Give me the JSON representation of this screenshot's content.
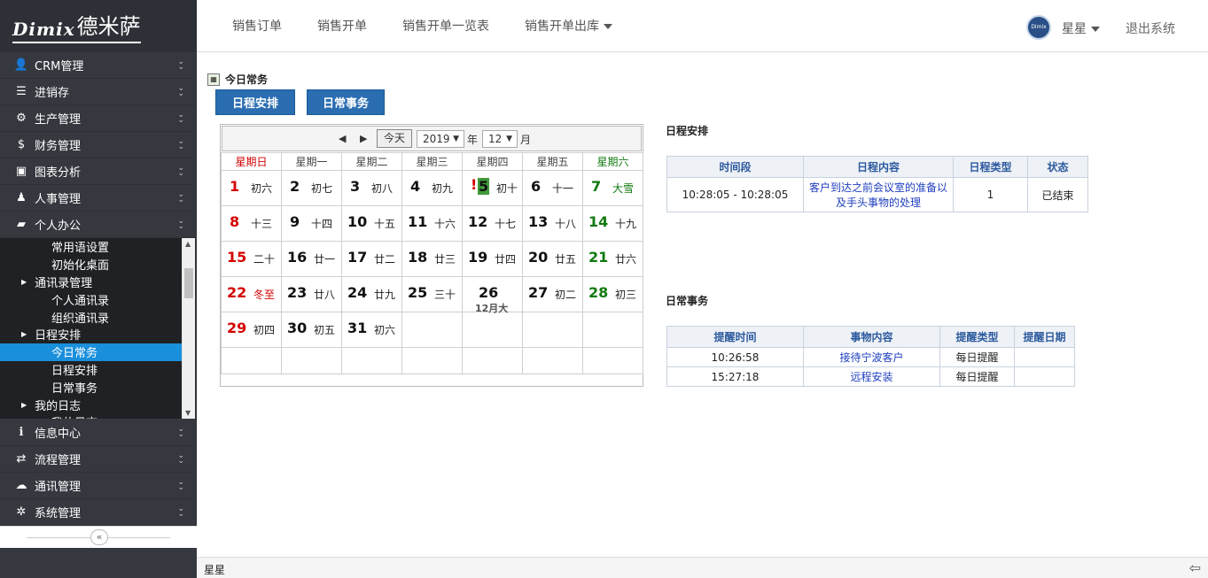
{
  "logo": {
    "brand": "Dimix",
    "cn": "德米萨"
  },
  "menu": [
    {
      "icon": "👤",
      "label": "CRM管理"
    },
    {
      "icon": "☰",
      "label": "进销存"
    },
    {
      "icon": "⚙",
      "label": "生产管理"
    },
    {
      "icon": "$",
      "label": "财务管理"
    },
    {
      "icon": "▣",
      "label": "图表分析"
    },
    {
      "icon": "♟",
      "label": "人事管理"
    },
    {
      "icon": "▰",
      "label": "个人办公"
    }
  ],
  "submenu": [
    {
      "label": "常用语设置",
      "level": 2
    },
    {
      "label": "初始化桌面",
      "level": 2
    },
    {
      "label": "通讯录管理",
      "level": 1
    },
    {
      "label": "个人通讯录",
      "level": 2
    },
    {
      "label": "组织通讯录",
      "level": 2
    },
    {
      "label": "日程安排",
      "level": 1
    },
    {
      "label": "今日常务",
      "level": 2,
      "active": true
    },
    {
      "label": "日程安排",
      "level": 2
    },
    {
      "label": "日常事务",
      "level": 2
    },
    {
      "label": "我的日志",
      "level": 1
    },
    {
      "label": "我的日志",
      "level": 2
    }
  ],
  "menu2": [
    {
      "icon": "ℹ",
      "label": "信息中心"
    },
    {
      "icon": "⇄",
      "label": "流程管理"
    },
    {
      "icon": "☁",
      "label": "通讯管理"
    },
    {
      "icon": "✲",
      "label": "系统管理"
    }
  ],
  "topnav": {
    "items": [
      "销售订单",
      "销售开单",
      "销售开单一览表",
      "销售开单出库"
    ],
    "avatar_text": "Dimix 德米萨",
    "user": "星星",
    "logout": "退出系统"
  },
  "page": {
    "title": "今日常务",
    "tab_schedule": "日程安排",
    "tab_affairs": "日常事务"
  },
  "calendar": {
    "today_label": "今天",
    "year": "2019",
    "year_suffix": "年",
    "month": "12",
    "month_suffix": "月",
    "weekdays": [
      "星期日",
      "星期一",
      "星期二",
      "星期三",
      "星期四",
      "星期五",
      "星期六"
    ],
    "weeks": [
      [
        {
          "d": "1",
          "l": "初六"
        },
        {
          "d": "2",
          "l": "初七"
        },
        {
          "d": "3",
          "l": "初八"
        },
        {
          "d": "4",
          "l": "初九"
        },
        {
          "d": "5",
          "l": "初十",
          "mark": "!"
        },
        {
          "d": "6",
          "l": "十一"
        },
        {
          "d": "7",
          "l": "大雪"
        }
      ],
      [
        {
          "d": "8",
          "l": "十三"
        },
        {
          "d": "9",
          "l": "十四"
        },
        {
          "d": "10",
          "l": "十五"
        },
        {
          "d": "11",
          "l": "十六"
        },
        {
          "d": "12",
          "l": "十七"
        },
        {
          "d": "13",
          "l": "十八"
        },
        {
          "d": "14",
          "l": "十九"
        }
      ],
      [
        {
          "d": "15",
          "l": "二十"
        },
        {
          "d": "16",
          "l": "廿一"
        },
        {
          "d": "17",
          "l": "廿二"
        },
        {
          "d": "18",
          "l": "廿三"
        },
        {
          "d": "19",
          "l": "廿四"
        },
        {
          "d": "20",
          "l": "廿五"
        },
        {
          "d": "21",
          "l": "廿六"
        }
      ],
      [
        {
          "d": "22",
          "l": "冬至"
        },
        {
          "d": "23",
          "l": "廿八"
        },
        {
          "d": "24",
          "l": "廿九"
        },
        {
          "d": "25",
          "l": "三十"
        },
        {
          "d": "26",
          "l": "12月大"
        },
        {
          "d": "27",
          "l": "初二"
        },
        {
          "d": "28",
          "l": "初三"
        }
      ],
      [
        {
          "d": "29",
          "l": "初四"
        },
        {
          "d": "30",
          "l": "初五"
        },
        {
          "d": "31",
          "l": "初六"
        },
        {
          "d": "",
          "l": ""
        },
        {
          "d": "",
          "l": ""
        },
        {
          "d": "",
          "l": ""
        },
        {
          "d": "",
          "l": ""
        }
      ],
      [
        {
          "d": "",
          "l": ""
        },
        {
          "d": "",
          "l": ""
        },
        {
          "d": "",
          "l": ""
        },
        {
          "d": "",
          "l": ""
        },
        {
          "d": "",
          "l": ""
        },
        {
          "d": "",
          "l": ""
        },
        {
          "d": "",
          "l": ""
        }
      ]
    ]
  },
  "schedule": {
    "heading": "日程安排",
    "columns": [
      "时间段",
      "日程内容",
      "日程类型",
      "状态"
    ],
    "rows": [
      [
        "10:28:05 - 10:28:05",
        "客户到达之前会议室的准备以及手头事物的处理",
        "1",
        "已结束"
      ]
    ]
  },
  "affairs": {
    "heading": "日常事务",
    "columns": [
      "提醒时间",
      "事物内容",
      "提醒类型",
      "提醒日期"
    ],
    "rows": [
      [
        "10:26:58",
        "接待宁波客户",
        "每日提醒",
        ""
      ],
      [
        "15:27:18",
        "远程安装",
        "每日提醒",
        ""
      ]
    ]
  },
  "status": {
    "user": "星星"
  },
  "colors": {
    "accent": "#2a6db1",
    "sidebar": "#35383f",
    "active": "#1a8fdc"
  }
}
